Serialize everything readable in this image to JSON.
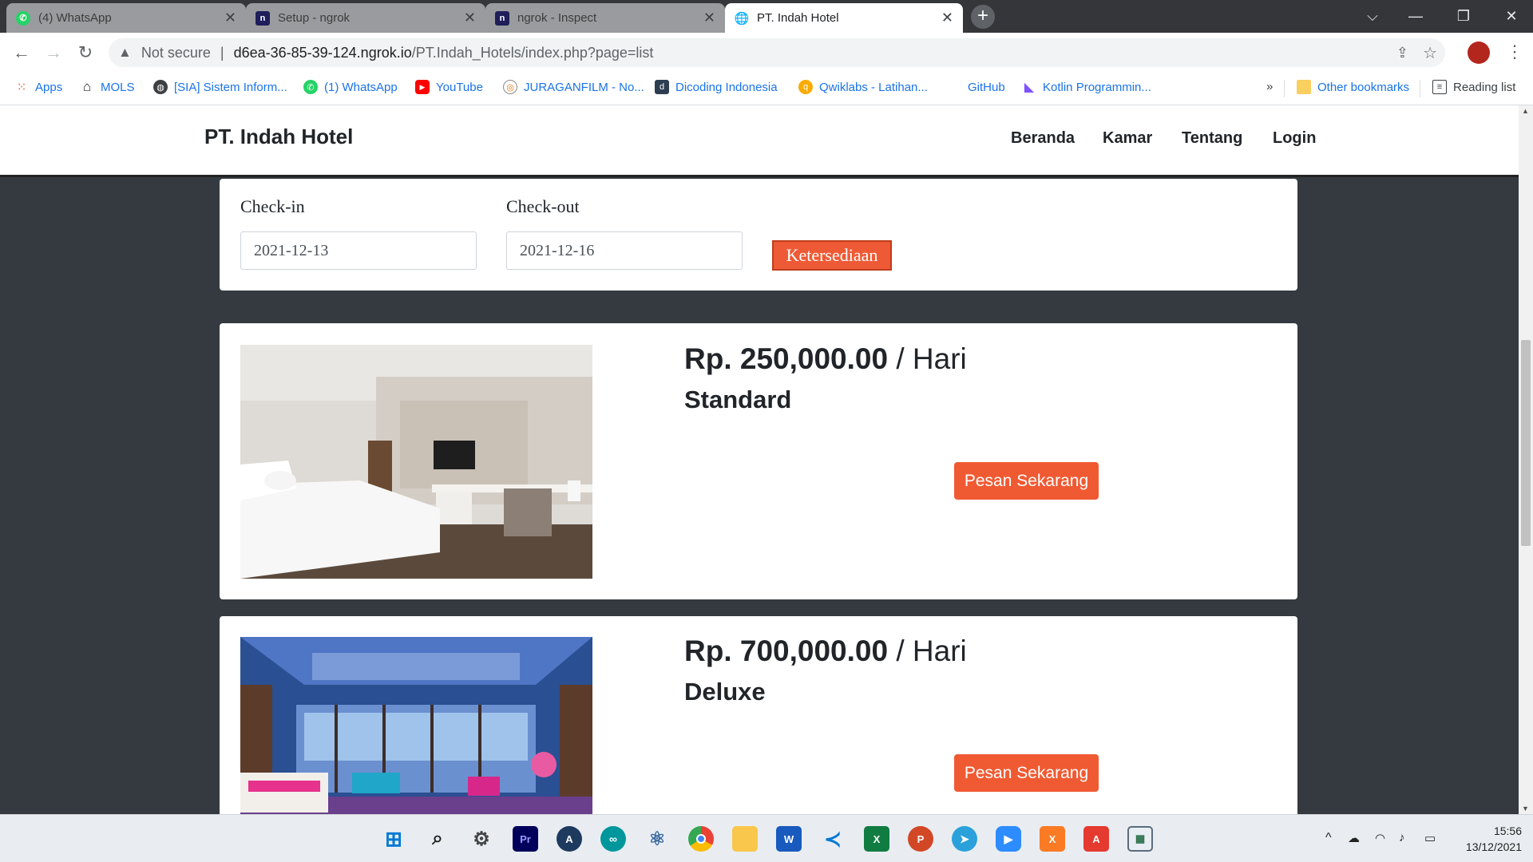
{
  "browser": {
    "tabs": [
      {
        "title": "(4) WhatsApp",
        "icon": "whatsapp-icon"
      },
      {
        "title": "Setup - ngrok",
        "icon": "ngrok-icon"
      },
      {
        "title": "ngrok - Inspect",
        "icon": "ngrok-icon"
      },
      {
        "title": "PT. Indah Hotel",
        "icon": "globe-icon",
        "active": true
      }
    ],
    "security_label": "Not secure",
    "url_host": "d6ea-36-85-39-124.ngrok.io",
    "url_path": "/PT.Indah_Hotels/index.php?page=list",
    "bookmarks": [
      {
        "label": "Apps",
        "icon": "apps-grid-icon"
      },
      {
        "label": "MOLS",
        "icon": "home-icon"
      },
      {
        "label": "[SIA] Sistem Inform...",
        "icon": "globe-icon"
      },
      {
        "label": "(1) WhatsApp",
        "icon": "whatsapp-icon"
      },
      {
        "label": "YouTube",
        "icon": "youtube-icon"
      },
      {
        "label": "JURAGANFILM - No...",
        "icon": "film-icon"
      },
      {
        "label": "Dicoding Indonesia",
        "icon": "dicoding-icon"
      },
      {
        "label": "Qwiklabs - Latihan...",
        "icon": "qwiklabs-icon"
      },
      {
        "label": "GitHub",
        "icon": "github-icon"
      },
      {
        "label": "Kotlin Programmin...",
        "icon": "kotlin-icon"
      }
    ],
    "overflow": "»",
    "other_bookmarks": "Other bookmarks",
    "reading_list": "Reading list"
  },
  "site": {
    "brand": "PT. Indah Hotel",
    "nav": [
      "Beranda",
      "Kamar",
      "Tentang",
      "Login"
    ]
  },
  "search": {
    "checkin_label": "Check-in",
    "checkin_value": "2021-12-13",
    "checkout_label": "Check-out",
    "checkout_value": "2021-12-16",
    "button": "Ketersediaan"
  },
  "rooms": [
    {
      "price": "Rp. 250,000.00",
      "unit": " / Hari",
      "type": "Standard",
      "button": "Pesan Sekarang"
    },
    {
      "price": "Rp. 700,000.00",
      "unit": " / Hari",
      "type": "Deluxe",
      "button": "Pesan Sekarang"
    }
  ],
  "taskbar": {
    "time": "15:56",
    "date": "13/12/2021"
  },
  "colors": {
    "accent": "#f05a32",
    "page_bg": "#343a40"
  }
}
